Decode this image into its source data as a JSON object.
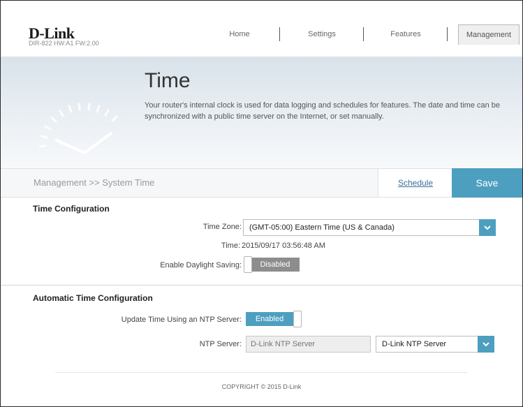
{
  "brand": {
    "logo": "D-Link",
    "model": "DIR-822 HW:A1 FW:2.00"
  },
  "nav": {
    "items": [
      "Home",
      "Settings",
      "Features",
      "Management"
    ],
    "active": "Management"
  },
  "banner": {
    "title": "Time",
    "description": "Your router's internal clock is used for data logging and schedules for features. The date and time can be synchronized with a public time server on the Internet, or set manually."
  },
  "breadcrumb": "Management >> System Time",
  "actions": {
    "schedule_label": "Schedule",
    "save_label": "Save"
  },
  "time_config": {
    "title": "Time Configuration",
    "time_zone_label": "Time Zone:",
    "time_zone_value": "(GMT-05:00) Eastern Time (US & Canada)",
    "time_label": "Time:",
    "time_value": "2015/09/17 03:56:48 AM",
    "daylight_label": "Enable Daylight Saving:",
    "daylight_state": "Disabled"
  },
  "auto_time": {
    "title": "Automatic Time Configuration",
    "ntp_update_label": "Update Time Using an NTP Server:",
    "ntp_update_state": "Enabled",
    "ntp_server_label": "NTP Server:",
    "ntp_server_placeholder": "D-Link NTP Server",
    "ntp_server_select": "D-Link NTP Server"
  },
  "footer": {
    "copyright": "COPYRIGHT © 2015 D-Link"
  },
  "colors": {
    "accent": "#4d9fc0",
    "toggle_off": "#8d8d8d",
    "link": "#3a6f9c"
  },
  "icons": {
    "clock": "clock-gauge-icon",
    "dropdown": "chevron-down-icon"
  }
}
